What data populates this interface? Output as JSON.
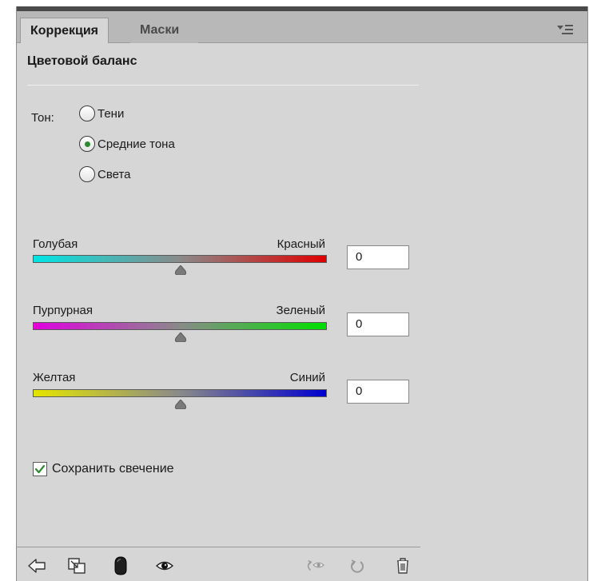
{
  "tabs": [
    {
      "label": "Коррекция",
      "active": true
    },
    {
      "label": "Маски",
      "active": false
    }
  ],
  "panel_title": "Цветовой баланс",
  "tone": {
    "label": "Тон:",
    "options": [
      {
        "label": "Тени",
        "checked": false
      },
      {
        "label": "Средние тона",
        "checked": true
      },
      {
        "label": "Света",
        "checked": false
      }
    ]
  },
  "sliders": [
    {
      "left_label": "Голубая",
      "right_label": "Красный",
      "value": "0",
      "left_color": "#00e5e5",
      "right_color": "#e00000"
    },
    {
      "left_label": "Пурпурная",
      "right_label": "Зеленый",
      "value": "0",
      "left_color": "#e000e0",
      "right_color": "#00e000"
    },
    {
      "left_label": "Желтая",
      "right_label": "Синий",
      "value": "0",
      "left_color": "#e5e500",
      "right_color": "#0000d0"
    }
  ],
  "preserve_luminosity": {
    "label": "Сохранить свечение",
    "checked": true
  },
  "toolbar": {
    "icons": [
      "back-arrow-icon",
      "clip-to-layer-icon",
      "layer-mask-icon",
      "eye-icon",
      "previous-state-icon",
      "reset-icon",
      "trash-icon"
    ]
  },
  "colors": {
    "panel_bg": "#d6d6d6",
    "tab_strip": "#b8b8b8",
    "radio_checked": "#2f8a2f",
    "checkbox_check": "#2f8a2f"
  }
}
